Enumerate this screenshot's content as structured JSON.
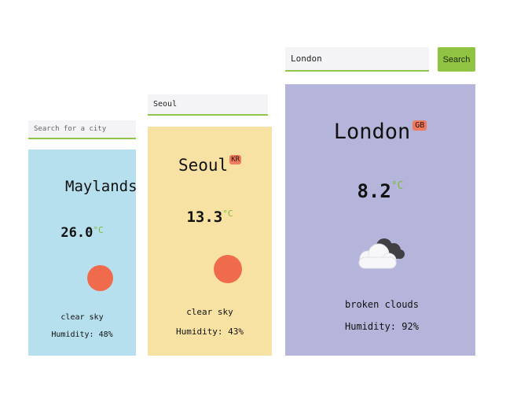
{
  "cards": [
    {
      "search": {
        "value": "",
        "placeholder": "Search for a city"
      },
      "city": "Maylands",
      "country": "",
      "temperature": "26.0",
      "unit": "°C",
      "icon": "sun-icon",
      "description": "clear sky",
      "humidity": "Humidity: 48%",
      "background": "#b7e0ee"
    },
    {
      "search": {
        "value": "Seoul",
        "placeholder": ""
      },
      "city": "Seoul",
      "country": "KR",
      "temperature": "13.3",
      "unit": "°C",
      "icon": "sun-icon",
      "description": "clear sky",
      "humidity": "Humidity: 43%",
      "background": "#f7e2a4"
    },
    {
      "search": {
        "value": "London",
        "placeholder": ""
      },
      "search_button": "Search",
      "city": "London",
      "country": "GB",
      "temperature": "8.2",
      "unit": "°C",
      "icon": "broken-clouds-icon",
      "description": "broken clouds",
      "humidity": "Humidity: 92%",
      "background": "#b5b5db"
    }
  ],
  "colors": {
    "accent_green": "#8fc341",
    "badge": "#ef7a5e",
    "sun": "#ef6b4c"
  }
}
